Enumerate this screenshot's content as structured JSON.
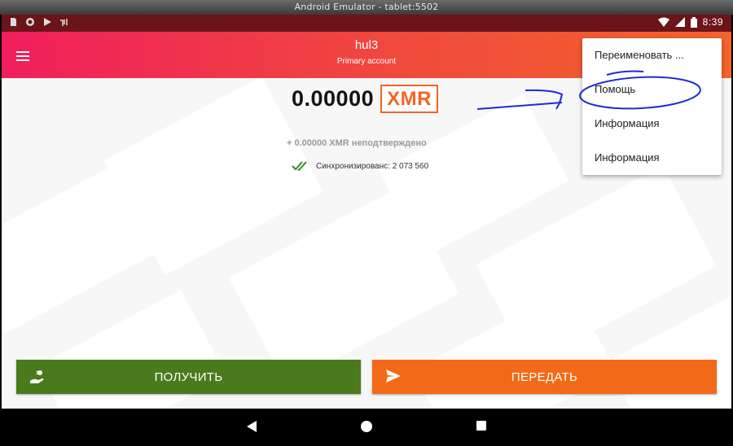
{
  "window": {
    "title": "Android Emulator - tablet:5502"
  },
  "status_bar": {
    "time": "8:39",
    "left_icons": [
      "sd-card-icon",
      "record-icon",
      "play-store-icon",
      "notification-icon"
    ],
    "right_icons": [
      "wifi-icon",
      "signal-icon",
      "battery-icon"
    ]
  },
  "app_bar": {
    "wallet_name": "hul3",
    "account_name": "Primary account"
  },
  "balance": {
    "amount": "0.00000",
    "unit": "XMR",
    "unconfirmed": "+ 0.00000 XMR неподтверждено",
    "sync_text": "Синхронизированс: 2 073 560"
  },
  "buttons": {
    "receive": "ПОЛУЧИТЬ",
    "send": "ПЕРЕДАТЬ"
  },
  "overflow_menu": {
    "items": [
      {
        "label": "Переименовать ..."
      },
      {
        "label": "Помощь"
      },
      {
        "label": "Информация"
      },
      {
        "label": "Информация"
      }
    ]
  },
  "colors": {
    "status_bar": "#6b1419",
    "app_bar_start": "#f01e5c",
    "app_bar_end": "#f2642c",
    "accent": "#f26522",
    "receive": "#4b7a1d",
    "send": "#f26a18",
    "annotation": "#1f2bd6"
  }
}
